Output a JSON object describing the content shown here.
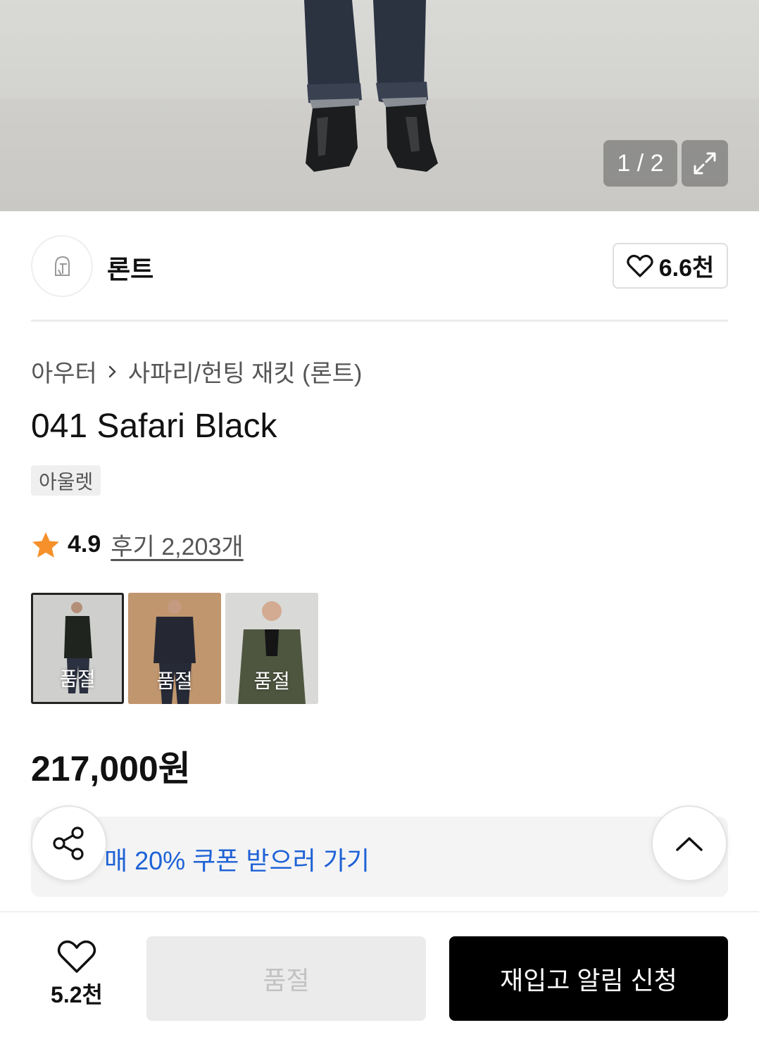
{
  "gallery": {
    "counter": "1 / 2"
  },
  "brand": {
    "name": "론트",
    "like_count": "6.6천"
  },
  "breadcrumb": {
    "category": "아우터",
    "subcategory": "사파리/헌팅 재킷 (론트)"
  },
  "product": {
    "title": "041 Safari Black",
    "tag": "아울렛",
    "rating": "4.9",
    "review_link": "후기 2,203개",
    "price": "217,000원"
  },
  "variants": [
    {
      "label": "품절",
      "selected": true
    },
    {
      "label": "품절",
      "selected": false
    },
    {
      "label": "품절",
      "selected": false
    }
  ],
  "coupon": {
    "text": "매 20% 쿠폰 받으러 가기"
  },
  "bottom_bar": {
    "wish_count": "5.2천",
    "soldout_label": "품절",
    "restock_label": "재입고 알림 신청"
  },
  "colors": {
    "accent_blue": "#1e62d6",
    "star": "#f5902a",
    "primary_button": "#000000"
  }
}
